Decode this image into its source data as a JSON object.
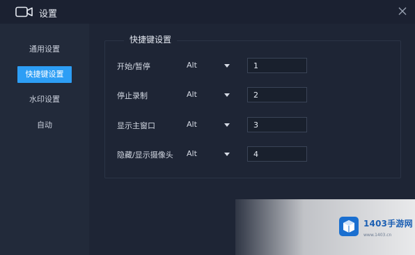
{
  "window": {
    "title": "设置"
  },
  "sidebar": {
    "items": [
      {
        "label": "通用设置",
        "active": false
      },
      {
        "label": "快捷键设置",
        "active": true
      },
      {
        "label": "水印设置",
        "active": false
      },
      {
        "label": "自动",
        "active": false
      }
    ]
  },
  "shortcuts": {
    "title": "快捷键设置",
    "rows": [
      {
        "label": "开始/暂停",
        "modifier": "Alt",
        "key": "1"
      },
      {
        "label": "停止录制",
        "modifier": "Alt",
        "key": "2"
      },
      {
        "label": "显示主窗口",
        "modifier": "Alt",
        "key": "3"
      },
      {
        "label": "隐藏/显示摄像头",
        "modifier": "Alt",
        "key": "4"
      }
    ]
  },
  "watermark": {
    "brand": "1403手游网",
    "url": "www.1403.cn"
  },
  "colors": {
    "accent": "#2d9ef5",
    "background": "#1e2535",
    "sidebar": "#222a3a"
  },
  "icons": {
    "app": "camera-icon",
    "close": "close-icon",
    "watermark_logo": "cube-icon"
  }
}
